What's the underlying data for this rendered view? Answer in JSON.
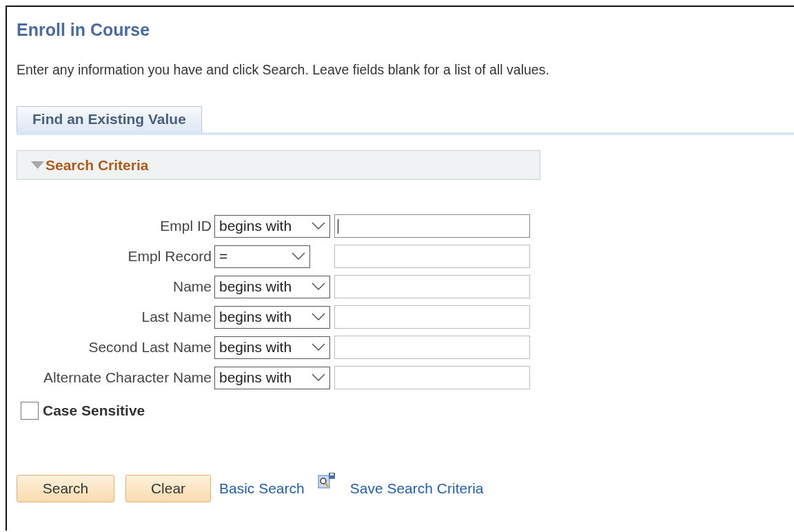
{
  "page": {
    "title": "Enroll in Course",
    "instructions": "Enter any information you have and click Search. Leave fields blank for a list of all values."
  },
  "tabs": [
    {
      "label": "Find an Existing Value",
      "selected": true
    }
  ],
  "section": {
    "title": "Search Criteria",
    "expanded": true
  },
  "criteria": [
    {
      "label": "Empl ID",
      "kind": "text",
      "operator": "begins with",
      "focused": true
    },
    {
      "label": "Empl Record",
      "kind": "number",
      "operator": "=",
      "focused": false
    },
    {
      "label": "Name",
      "kind": "text",
      "operator": "begins with",
      "focused": false
    },
    {
      "label": "Last Name",
      "kind": "text",
      "operator": "begins with",
      "focused": false
    },
    {
      "label": "Second Last Name",
      "kind": "text",
      "operator": "begins with",
      "focused": false
    },
    {
      "label": "Alternate Character Name",
      "kind": "text",
      "operator": "begins with",
      "focused": false
    }
  ],
  "case_sensitive": {
    "label": "Case Sensitive",
    "checked": false
  },
  "buttons": [
    "Search",
    "Clear"
  ],
  "links": [
    {
      "label": "Basic Search",
      "icon": false
    },
    {
      "label": "Save Search Criteria",
      "icon": true
    }
  ]
}
